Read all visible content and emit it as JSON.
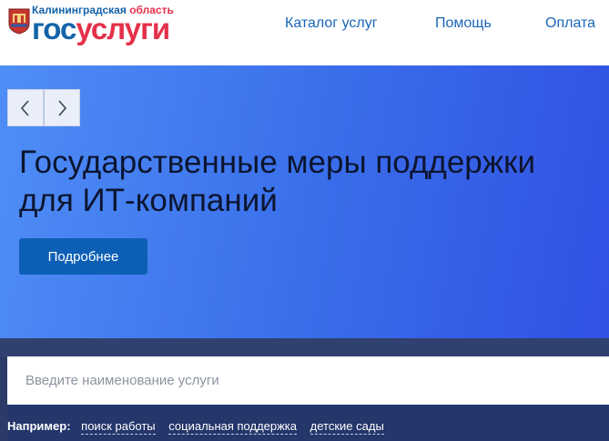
{
  "header": {
    "region_top": "Калининградская",
    "region_bottom": "область",
    "brand_gos": "гос",
    "brand_uslugi": "услуги"
  },
  "nav": {
    "items": [
      "Каталог услуг",
      "Помощь",
      "Оплата"
    ]
  },
  "hero": {
    "title_line1": "Государственные меры поддержки",
    "title_line2": "для ИТ-компаний",
    "button_label": "Подробнее"
  },
  "search": {
    "placeholder": "Введите наименование услуги",
    "examples_label": "Например:",
    "examples": [
      "поиск работы",
      "социальная поддержка",
      "детские сады"
    ]
  }
}
